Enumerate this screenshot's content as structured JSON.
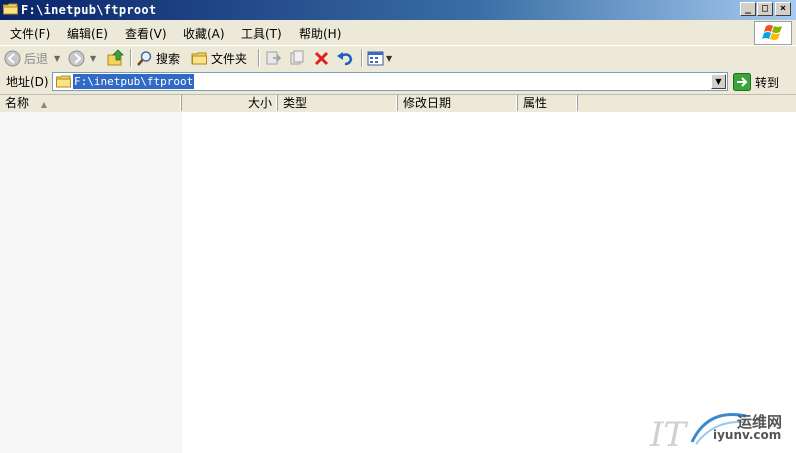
{
  "window": {
    "title": "F:\\inetpub\\ftproot",
    "buttons": {
      "minimize": "_",
      "maximize": "□",
      "close": "×"
    }
  },
  "menu": [
    "文件(F)",
    "编辑(E)",
    "查看(V)",
    "收藏(A)",
    "工具(T)",
    "帮助(H)"
  ],
  "toolbar": {
    "back": "后退",
    "search": "搜索",
    "folders": "文件夹"
  },
  "address": {
    "label": "地址(D)",
    "value": "F:\\inetpub\\ftproot",
    "go": "转到"
  },
  "columns": [
    "名称",
    "大小",
    "类型",
    "修改日期",
    "属性"
  ],
  "watermark": {
    "line1": "运维网",
    "line2": "iyunv.com"
  },
  "colors": {
    "title_start": "#0a246a",
    "title_end": "#a6caf0",
    "selection": "#316ac5",
    "chrome": "#ece9d8"
  }
}
